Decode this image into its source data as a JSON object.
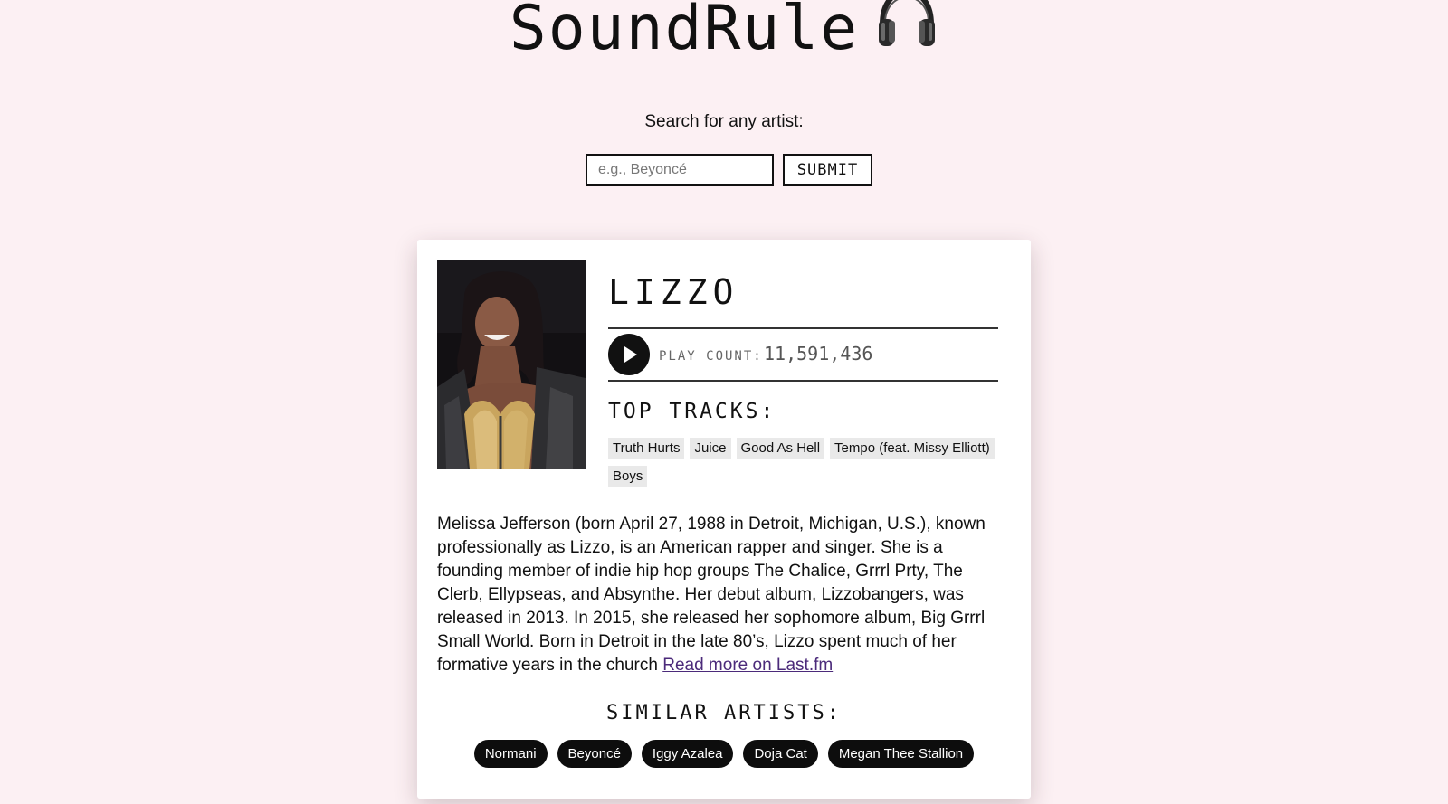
{
  "app": {
    "title": "SoundRule"
  },
  "search": {
    "label": "Search for any artist:",
    "placeholder": "e.g., Beyoncé",
    "value": "",
    "submit_label": "SUBMIT"
  },
  "artist": {
    "name": "LIZZO",
    "play_count_label": "PLAY COUNT:",
    "play_count": "11,591,436",
    "top_tracks_heading": "TOP TRACKS:",
    "top_tracks": [
      "Truth Hurts",
      "Juice",
      "Good As Hell",
      "Tempo (feat. Missy Elliott)",
      "Boys"
    ],
    "bio": "Melissa Jefferson (born April 27, 1988 in Detroit, Michigan, U.S.), known professionally as Lizzo, is an American rapper and singer. She is a founding member of indie hip hop groups The Chalice, Grrrl Prty, The Clerb, Ellypseas, and Absynthe. Her debut album, Lizzobangers, was released in 2013. In 2015, she released her sophomore album, Big Grrrl Small World. Born in Detroit in the late 80’s, Lizzo spent much of her formative years in the church",
    "read_more_label": "Read more on Last.fm",
    "similar_heading": "SIMILAR ARTISTS:",
    "similar_artists": [
      "Normani",
      "Beyoncé",
      "Iggy Azalea",
      "Doja Cat",
      "Megan Thee Stallion"
    ]
  },
  "colors": {
    "page_background": "#fcf0f3",
    "card_background": "#ffffff",
    "pill_background": "#0d0d0d",
    "tag_background": "#e9e9e9",
    "link": "#4b2a7a"
  },
  "icons": {
    "title_icon": "headphones-icon",
    "play_icon": "play-icon"
  }
}
